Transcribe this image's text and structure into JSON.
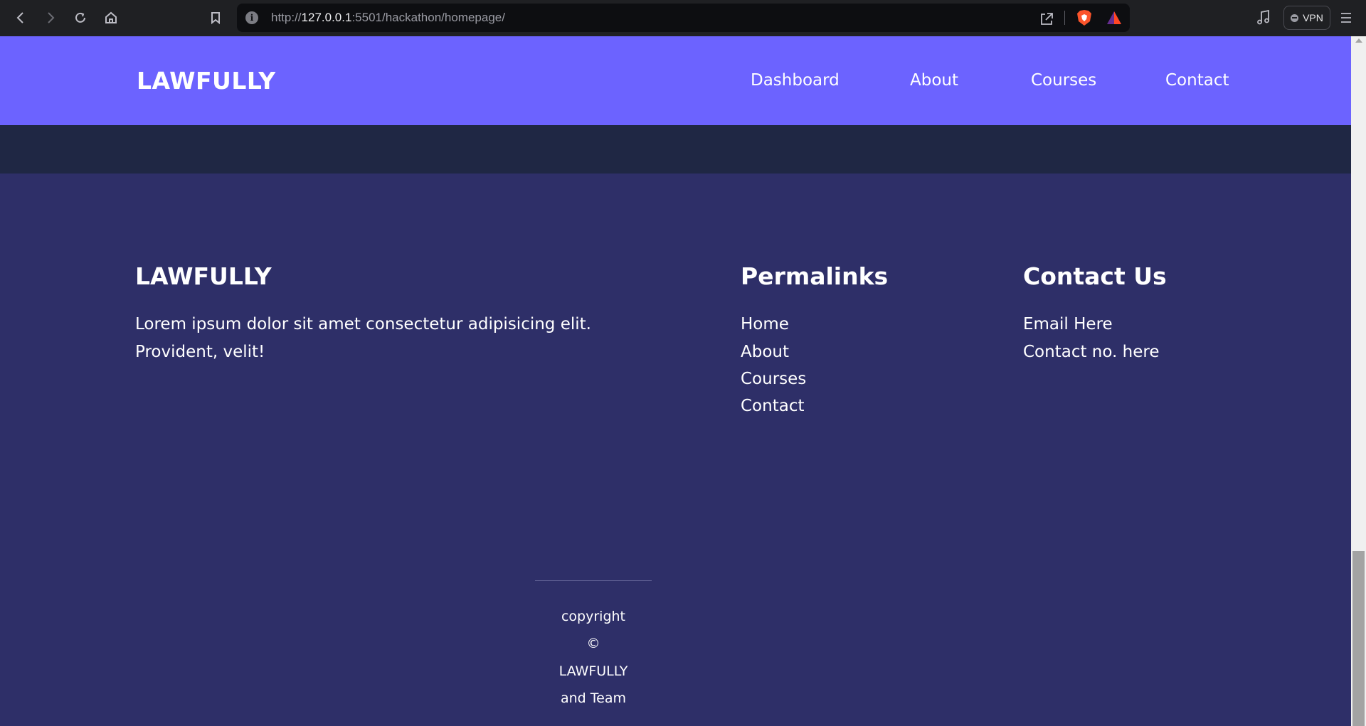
{
  "browser": {
    "url_scheme": "http://",
    "url_host": "127.0.0.1",
    "url_port": ":5501",
    "url_path": "/hackathon/homepage/",
    "vpn_label": "VPN"
  },
  "header": {
    "logo": "LAWFULLY",
    "nav": [
      "Dashboard",
      "About",
      "Courses",
      "Contact"
    ]
  },
  "footer": {
    "brand": {
      "title": "LAWFULLY",
      "description_line1": "Lorem ipsum dolor sit amet consectetur adipisicing elit.",
      "description_line2": "Provident, velit!"
    },
    "permalinks": {
      "title": "Permalinks",
      "links": [
        "Home",
        "About",
        "Courses",
        "Contact"
      ]
    },
    "contact": {
      "title": "Contact Us",
      "items": [
        "Email Here",
        "Contact no. here"
      ]
    },
    "copyright": [
      "copyright",
      "©",
      "LAWFULLY",
      "and Team"
    ]
  },
  "colors": {
    "header_bg": "#6c63ff",
    "band_bg": "#1f2744",
    "footer_bg": "#2e2f68"
  }
}
